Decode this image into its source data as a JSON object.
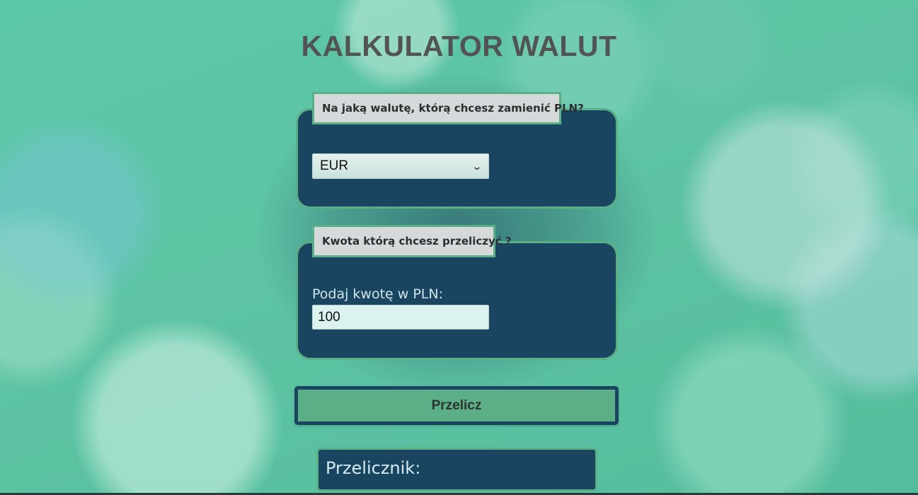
{
  "header": {
    "title": "KALKULATOR WALUT"
  },
  "currency_section": {
    "legend": "Na jaką walutę, którą chcesz zamienić PLN?",
    "selected_currency": "EUR",
    "chevron_icon": "chevron-down-icon"
  },
  "amount_section": {
    "legend": "Kwota którą chcesz przeliczyć ?",
    "label": "Podaj kwotę w PLN:",
    "value": "100"
  },
  "actions": {
    "convert_label": "Przelicz"
  },
  "result": {
    "label": "Przelicznik:"
  },
  "colors": {
    "panel": "#1a4560",
    "accent_green": "#5aaf87",
    "title": "#525355",
    "background": "#5cc7a7"
  }
}
